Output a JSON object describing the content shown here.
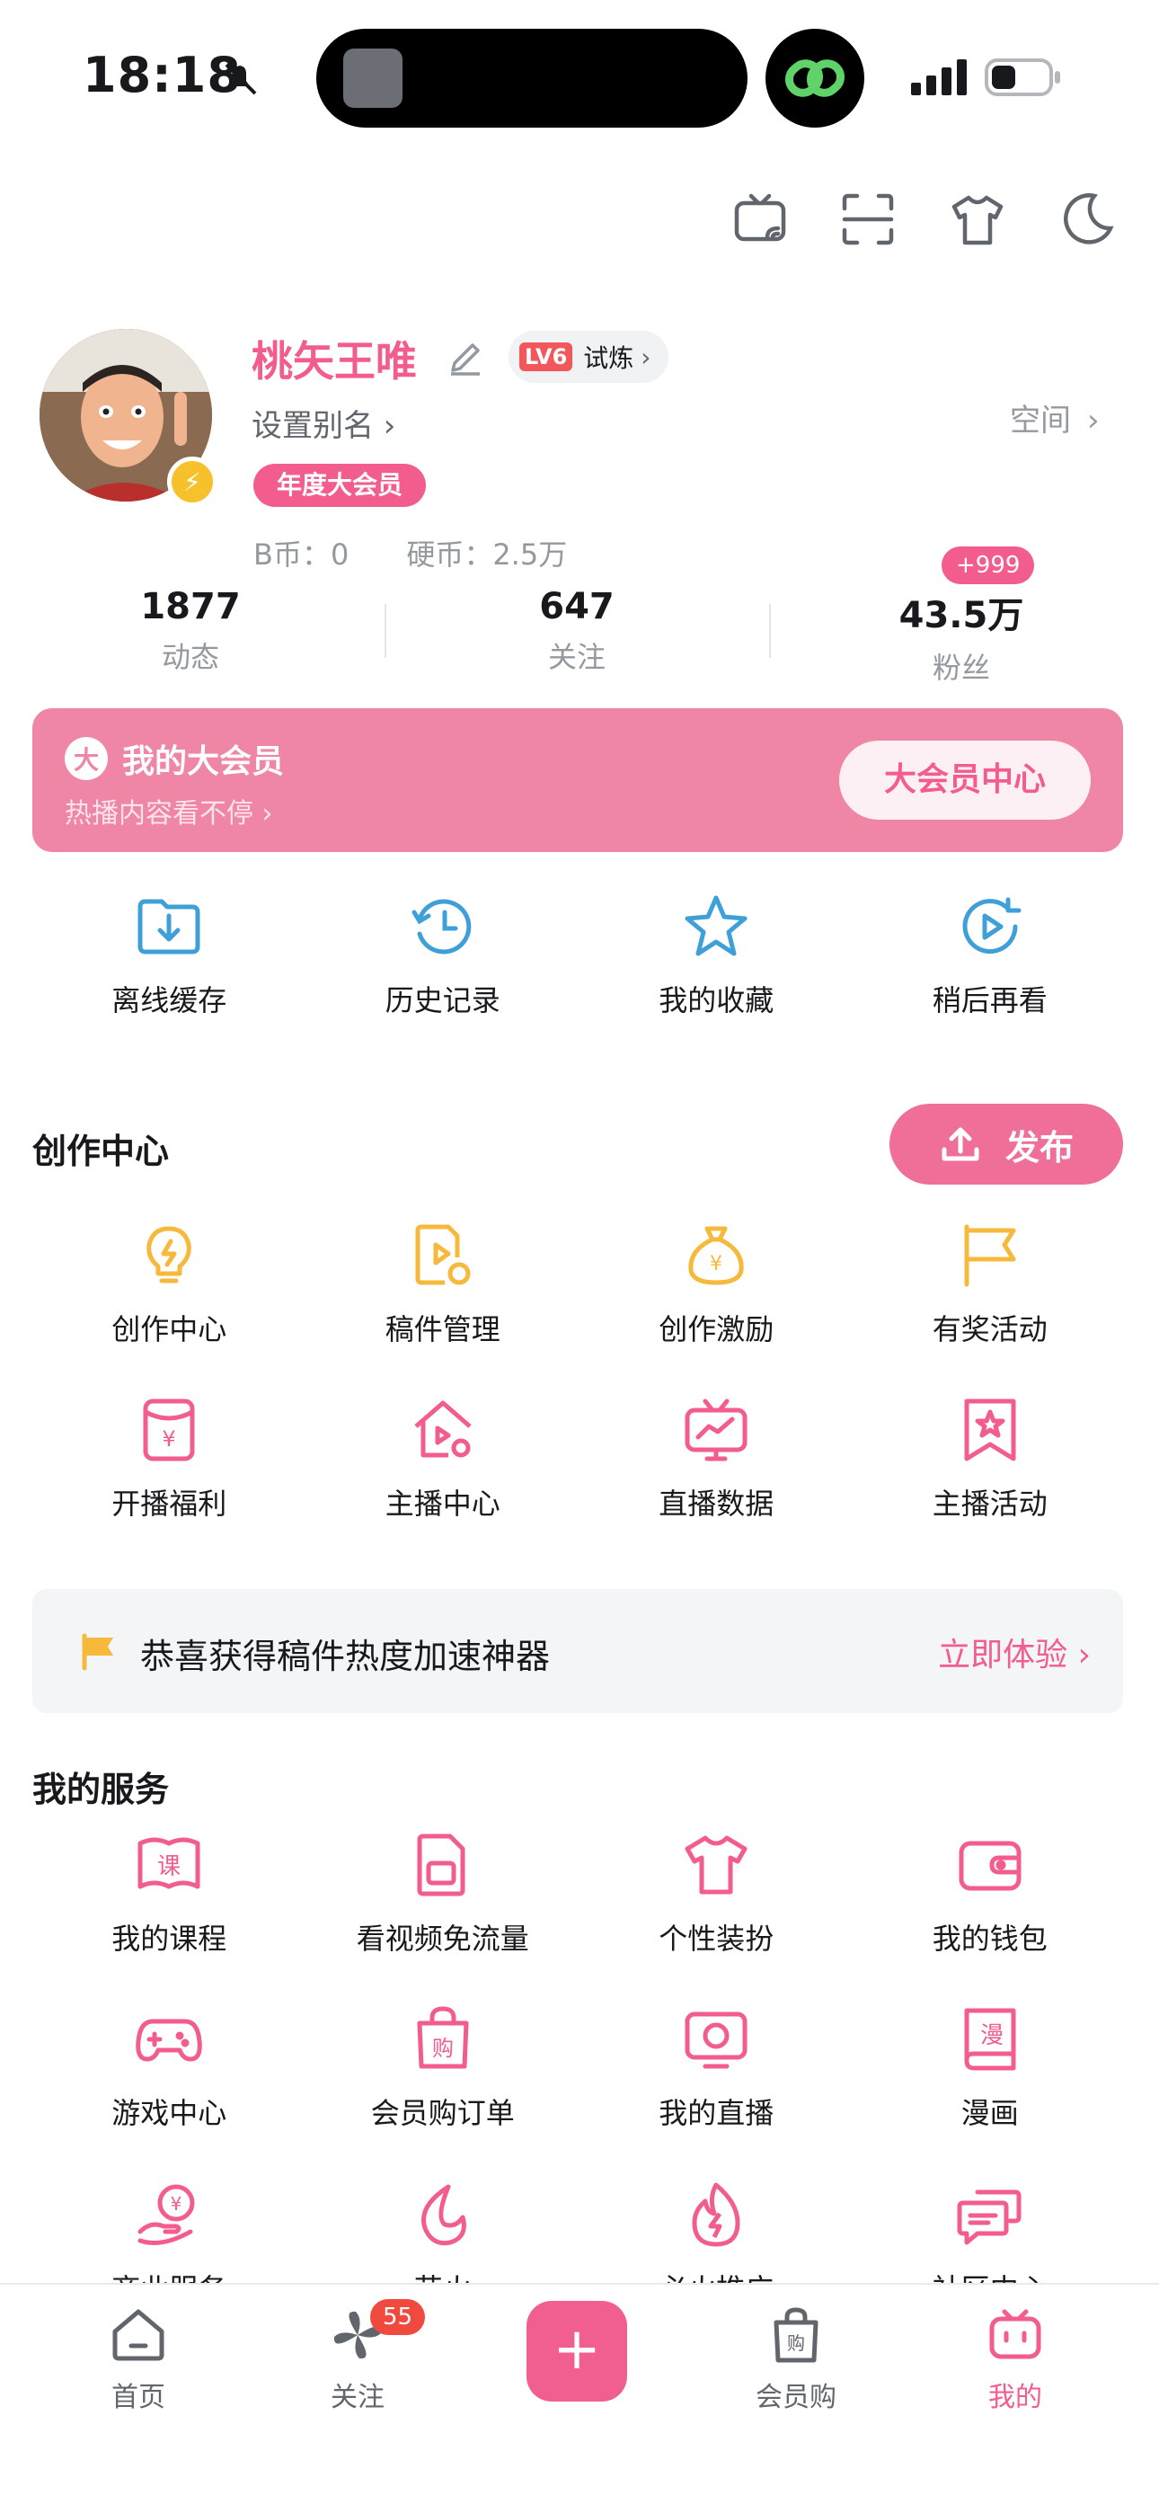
{
  "status": {
    "time": "18:18"
  },
  "profile": {
    "name": "桃矢王唯",
    "level_tag": "LV6",
    "level_label": "试炼",
    "alias": "设置别名 ›",
    "space": "空间",
    "vip_tag": "年度大会员",
    "coins": "B币：0　　硬币：2.5万"
  },
  "stats": [
    {
      "num": "1877",
      "label": "动态"
    },
    {
      "num": "647",
      "label": "关注"
    },
    {
      "num": "43.5万",
      "label": "粉丝",
      "badge": "+999"
    }
  ],
  "vip": {
    "title": "我的大会员",
    "icon_char": "大",
    "subtitle": "热播内容看不停 ›",
    "button": "大会员中心"
  },
  "quick": [
    {
      "label": "离线缓存",
      "icon": "download-folder-icon"
    },
    {
      "label": "历史记录",
      "icon": "history-icon"
    },
    {
      "label": "我的收藏",
      "icon": "star-icon"
    },
    {
      "label": "稍后再看",
      "icon": "watch-later-icon"
    }
  ],
  "creation": {
    "title": "创作中心",
    "publish": "发布",
    "row1": [
      {
        "label": "创作中心",
        "icon": "lightbulb-icon"
      },
      {
        "label": "稿件管理",
        "icon": "manuscript-icon"
      },
      {
        "label": "创作激励",
        "icon": "money-bag-icon"
      },
      {
        "label": "有奖活动",
        "icon": "flag-icon"
      }
    ],
    "row2": [
      {
        "label": "开播福利",
        "icon": "red-envelope-icon"
      },
      {
        "label": "主播中心",
        "icon": "streamer-home-icon"
      },
      {
        "label": "直播数据",
        "icon": "tv-chart-icon"
      },
      {
        "label": "主播活动",
        "icon": "bookmark-star-icon"
      }
    ]
  },
  "promo": {
    "text": "恭喜获得稿件热度加速神器",
    "action": "立即体验 ›"
  },
  "services": {
    "title": "我的服务",
    "row1": [
      {
        "label": "我的课程",
        "icon": "course-icon",
        "glyph": "课"
      },
      {
        "label": "看视频免流量",
        "icon": "sim-card-icon"
      },
      {
        "label": "个性装扮",
        "icon": "tshirt-icon"
      },
      {
        "label": "我的钱包",
        "icon": "wallet-icon"
      }
    ],
    "row2": [
      {
        "label": "游戏中心",
        "icon": "gamepad-icon"
      },
      {
        "label": "会员购订单",
        "icon": "shopping-bag-icon",
        "glyph": "购"
      },
      {
        "label": "我的直播",
        "icon": "camera-icon"
      },
      {
        "label": "漫画",
        "icon": "comic-icon",
        "glyph": "漫"
      }
    ],
    "row3": [
      {
        "label": "商业服务",
        "icon": "business-icon"
      },
      {
        "label": "花火",
        "icon": "flame-icon"
      },
      {
        "label": "必火推广",
        "icon": "fire-icon"
      },
      {
        "label": "社区中心",
        "icon": "chat-icon"
      }
    ]
  },
  "tabs": [
    {
      "label": "首页"
    },
    {
      "label": "关注",
      "badge": "55"
    },
    {
      "label": "会员购",
      "glyph": "购"
    },
    {
      "label": "我的"
    }
  ],
  "colors": {
    "pink": "#f25d8e",
    "gold": "#f6b93b",
    "blue": "#3fa0d9",
    "card": "#ef86a6"
  }
}
